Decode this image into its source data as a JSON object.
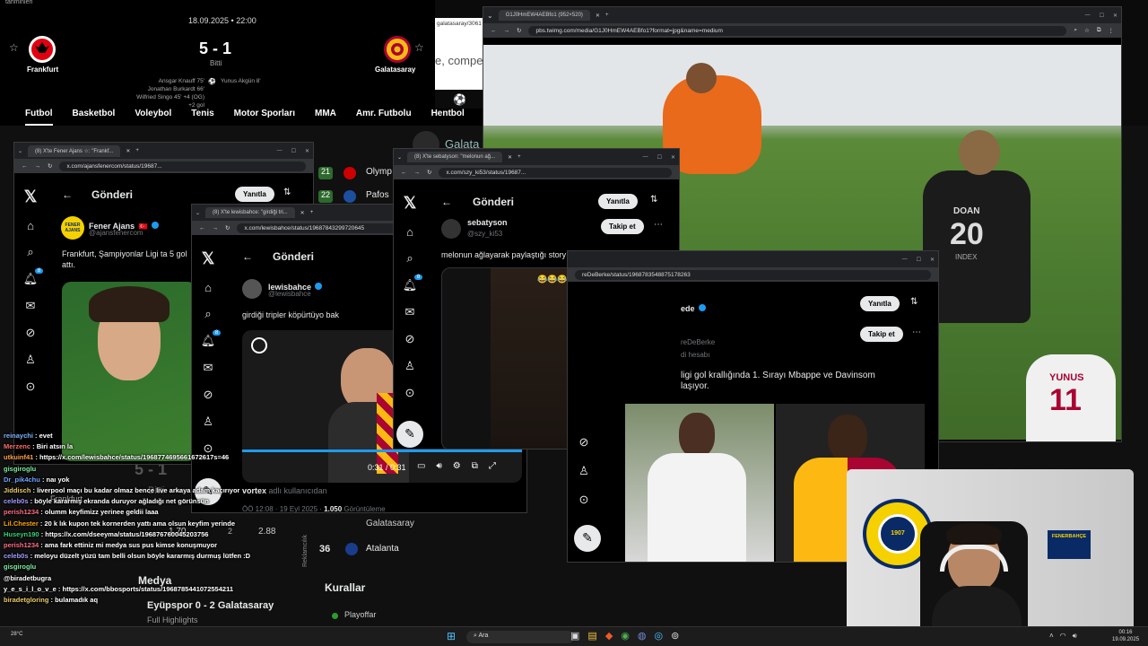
{
  "score_page": {
    "top_label": "tahminleri",
    "date": "18.09.2025 • 22:00",
    "home_team": "Frankfurt",
    "away_team": "Galatasaray",
    "score": "5 - 1",
    "status": "Bitti",
    "home_scorers": [
      "Ansgar Knauff 75'",
      "Jonathan Burkardt 66'",
      "Wilfried Singo 45' +4 (OG)",
      "+2 gol"
    ],
    "away_scorers": [
      "Yunus Akgün 8'"
    ],
    "compet_text": "e, compet"
  },
  "sport_tabs": [
    "Futbol",
    "Basketbol",
    "Voleybol",
    "Tenis",
    "Motor Sporları",
    "MMA",
    "Amr. Futbolu",
    "Hentbol"
  ],
  "image_window": {
    "tab_title": "G1J0HmEW4AEBfo1 (952×520)",
    "url": "pbs.twimg.com/media/G1J0HmEW4AEBfo1?format=jpg&name=medium",
    "prev_url_fragment": "galatasaray/3061",
    "jersey_20_name": "DOAN",
    "jersey_20_num": "20",
    "jersey_20_sponsor": "INDEX",
    "jersey_11_name": "YUNUS",
    "jersey_11_num": "11"
  },
  "fener_window": {
    "tab_title": "(8) X'te Fener Ajans ☆: \"Frankf...",
    "url": "x.com/ajansfenercom/status/19687...",
    "header": "Gönderi",
    "reply_button": "Yanıtla",
    "user_name": "Fener Ajans",
    "flag": "🇹🇷",
    "handle": "@ajansfenercom",
    "avatar_text": "FENER AJANS",
    "text": "Frankfurt, Şampiyonlar Ligi ta 5 gol attı.",
    "notif_badge": "8"
  },
  "lewis_window": {
    "tab_title": "(8) X'te lewisbahce: \"girdiği tri...",
    "url": "x.com/lewisbahce/status/19687843299720645",
    "header": "Gönderi",
    "user_name": "lewisbahce",
    "handle": "@lewisbahce",
    "text": "girdiği tripler köpürtüyo bak",
    "video_time": "0:31 / 0:31",
    "footer_user": "vortex",
    "footer_text": "adlı kullanıcıdan",
    "meta_time": "ÖÖ 12:08 · 19 Eyl 2025 ·",
    "meta_views": "1.050",
    "meta_views_label": "Görüntüleme",
    "notif_badge": "8"
  },
  "seba_window": {
    "tab_title": "(8) X'te sebatyson: \"melonun ağ...",
    "url": "x.com/szy_ki53/status/19687...",
    "header": "Gönderi",
    "reply_button": "Yanıtla",
    "user_name": "sebatyson",
    "handle": "@szy_ki53",
    "follow_button": "Takip et",
    "text": "melonun ağlayarak paylaştığı story",
    "emojis": "😂😂😂😂😂😂😂",
    "notif_badge": "8"
  },
  "berke_window": {
    "url": "reDeBerke/status/19687835488751782​63",
    "reply_button": "Yanıtla",
    "user_name_partial": "ede",
    "handle_partial": "reDeBerke",
    "sub_label": "di hesabı",
    "follow_button": "Takip et",
    "text_line1": "ligi gol krallığında 1. Sırayı Mbappe ve Davinsom",
    "text_line2": "laşıyor."
  },
  "background_page": {
    "standings": [
      {
        "rank": "21",
        "team": "Olymp"
      },
      {
        "rank": "22",
        "team": "Pafos"
      },
      {
        "rank": "36",
        "team": "Atalanta"
      }
    ],
    "kuralllar_title": "Kurallar",
    "playoff_label": "Playoffar",
    "galata_label": "Galata",
    "media_title": "Medya",
    "media_item": "Eyüpspor 0 - 2 Galatasaray",
    "media_sub": "Full Highlights",
    "ad_label": "Reklamcılık",
    "mini_score": "5 - 1",
    "mini_status": "Bitti",
    "mini_team": "Frankfurt",
    "odds": [
      "1.70",
      "2",
      "2.88"
    ],
    "galatasaray_row": "Galatasaray"
  },
  "chat": [
    {
      "user": "reinaychi",
      "color": "#7fb2ff",
      "text": "evet"
    },
    {
      "user": "Merzenc",
      "color": "#ff6b6b",
      "text": "Biri atsın la"
    },
    {
      "user": "utkuinf41",
      "color": "#ff9f43",
      "text": "https://x.com/lewisbahce/status/1968774695661672617s=46"
    },
    {
      "user": "gisgiroglu",
      "color": "#7bed9f",
      "text": ""
    },
    {
      "user": "Dr_pik4chu",
      "color": "#70a1ff",
      "text": "naı yok"
    },
    {
      "user": "Jiddisch",
      "color": "#eccc68",
      "text": "liverpool maçı bu kadar olmaz bence live arkaya adam kaçırıyor"
    },
    {
      "user": "celeb0s",
      "color": "#a29bfe",
      "text": "böyle kararmış ekranda duruyor ağladığı net görünsün"
    },
    {
      "user": "perish1234",
      "color": "#ff6b81",
      "text": "olumm keyfimizz yerinee geldii laaa"
    },
    {
      "user": "Lil.Chester",
      "color": "#ffa502",
      "text": "20 k lık kupon tek kornerden yattı ama olsun keyfim yerinde"
    },
    {
      "user": "Huseyn190",
      "color": "#2ed573",
      "text": "https://x.com/dseeyma/status/1968767600452​03756"
    },
    {
      "user": "perish1234",
      "color": "#ff6b81",
      "text": "ama fark ettiniz mi medya sus pus kimse konuşmuyor"
    },
    {
      "user": "celeb0s",
      "color": "#a29bfe",
      "text": "meloyu düzelt yüzü tam belli olsun böyle kararmış durmuş lütfen :D"
    },
    {
      "user": "gisgiroglu",
      "color": "#7bed9f",
      "text": ""
    },
    {
      "user": "@biradetbugra",
      "color": "#ffffff",
      "text": ""
    },
    {
      "user": "y_e_s_i_l_o_v_e",
      "color": "#ffffff",
      "text": "https://x.com/bbosports/status/1968785441072554211"
    },
    {
      "user": "biradetgloring",
      "color": "#eccc68",
      "text": "bulamadık aq"
    }
  ],
  "taskbar": {
    "weather_temp": "28°C",
    "search": "Ara",
    "time": "00:16",
    "date": "19.09.2025"
  },
  "webcam": {
    "badge_top": "FENERBAHÇE SPOR KULÜBÜ",
    "badge_year": "1907",
    "box_label": "FENERBAHÇE"
  },
  "colors": {
    "x_blue": "#1d9bf0",
    "fener_yellow": "#f5d100",
    "fener_navy": "#0a2a66",
    "gs_red": "#a90432",
    "gs_yellow": "#fdb912",
    "pitch_green": "#4a7a2f"
  }
}
